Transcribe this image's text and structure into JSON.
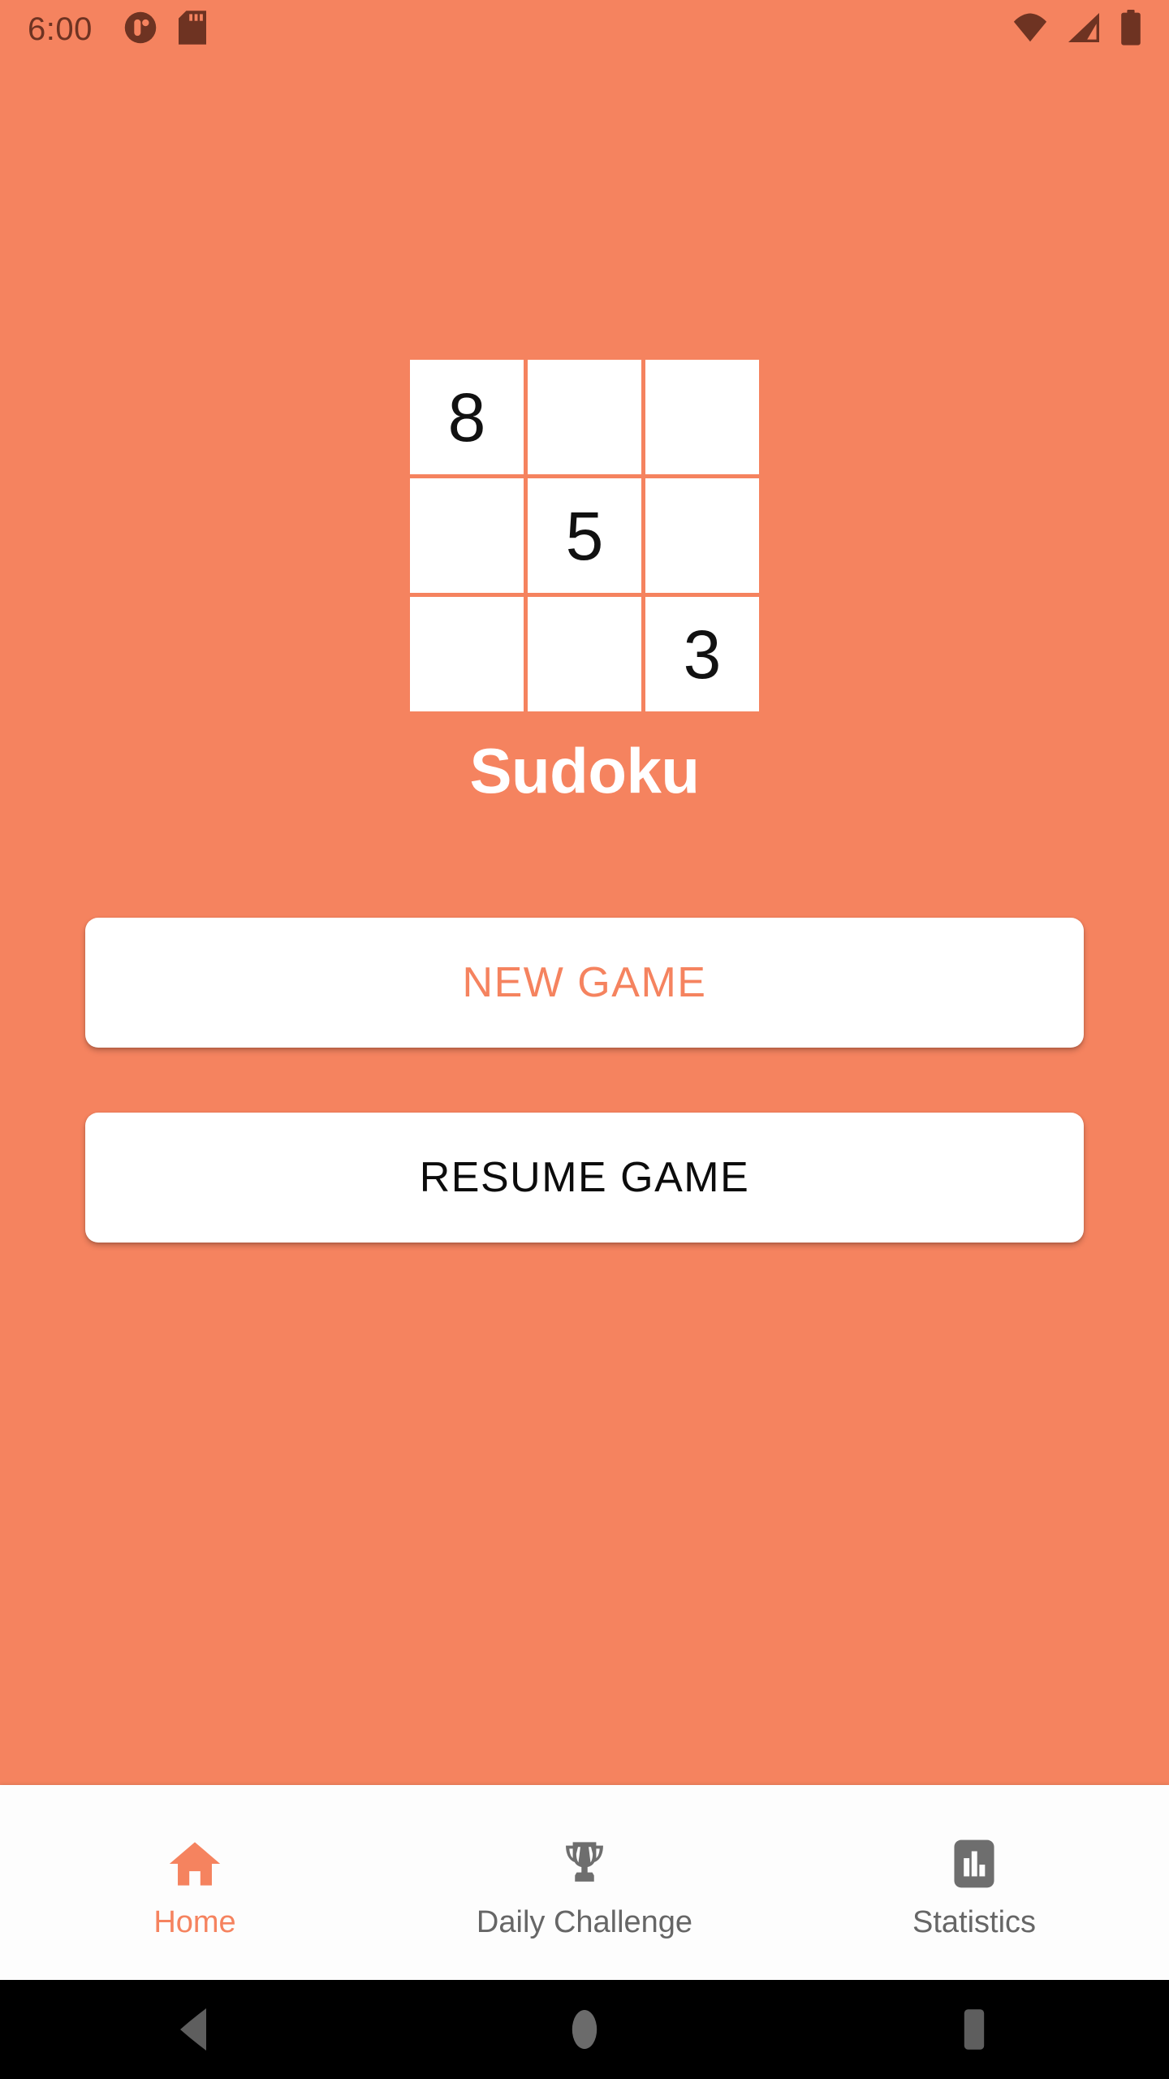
{
  "status_bar": {
    "clock": "6:00",
    "left_icons": [
      {
        "name": "app-notification-icon",
        "glyph": "circle-badge"
      },
      {
        "name": "sd-card-icon",
        "glyph": "sd-card"
      }
    ],
    "right_icons": [
      {
        "name": "wifi-icon",
        "glyph": "wifi"
      },
      {
        "name": "cellular-signal-icon",
        "glyph": "signal"
      },
      {
        "name": "battery-icon",
        "glyph": "battery-full"
      }
    ],
    "icon_color": "#6E3322"
  },
  "theme": {
    "background": "#F5835F",
    "accent": "#F5835F",
    "surface": "#FFFFFF",
    "text_primary": "#0C0C0C",
    "text_muted": "#666666",
    "system_nav_background": "#000000"
  },
  "logo": {
    "name": "sudoku-logo-grid",
    "cells": [
      "8",
      "",
      "",
      "",
      "5",
      "",
      "",
      "",
      "3"
    ]
  },
  "header": {
    "title": "Sudoku"
  },
  "actions": {
    "new_game_label": "NEW GAME",
    "resume_game_label": "RESUME GAME"
  },
  "bottom_nav": {
    "items": [
      {
        "label": "Home",
        "icon": "home-icon",
        "active": true
      },
      {
        "label": "Daily Challenge",
        "icon": "trophy-icon",
        "active": false
      },
      {
        "label": "Statistics",
        "icon": "bar-chart-icon",
        "active": false
      }
    ]
  },
  "system_nav": {
    "back_label": "Back",
    "home_label": "Home",
    "recents_label": "Recent apps"
  }
}
